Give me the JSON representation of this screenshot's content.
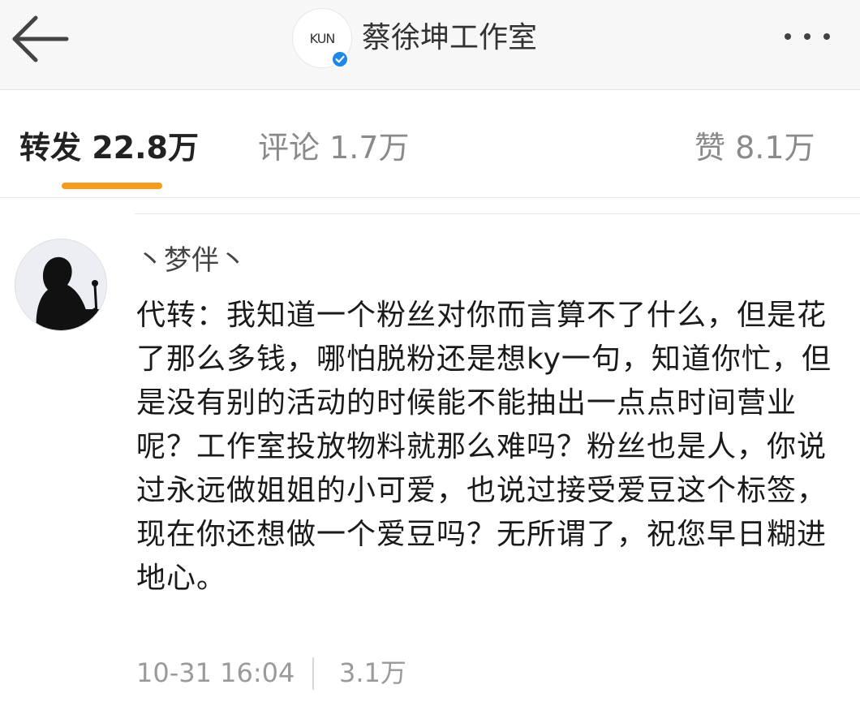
{
  "header": {
    "title": "蔡徐坤工作室",
    "logo_text": "KUN",
    "verified_color": "#1e88e5"
  },
  "tabs": [
    {
      "label": "转发 22.8万",
      "active": true
    },
    {
      "label": "评论 1.7万",
      "active": false
    },
    {
      "label": "赞 8.1万",
      "active": false
    }
  ],
  "accent_color": "#f79b1d",
  "comment": {
    "username": "丶梦伴丶",
    "text": "代转：我知道一个粉丝对你而言算不了什么，但是花了那么多钱，哪怕脱粉还是想ky一句，知道你忙，但是没有别的活动的时候能不能抽出一点点时间营业呢？工作室投放物料就那么难吗？粉丝也是人，你说过永远做姐姐的小可爱，也说过接受爱豆这个标签，现在你还想做一个爱豆吗？无所谓了，祝您早日糊进地心。",
    "timestamp": "10-31 16:04",
    "likes": "3.1万"
  }
}
